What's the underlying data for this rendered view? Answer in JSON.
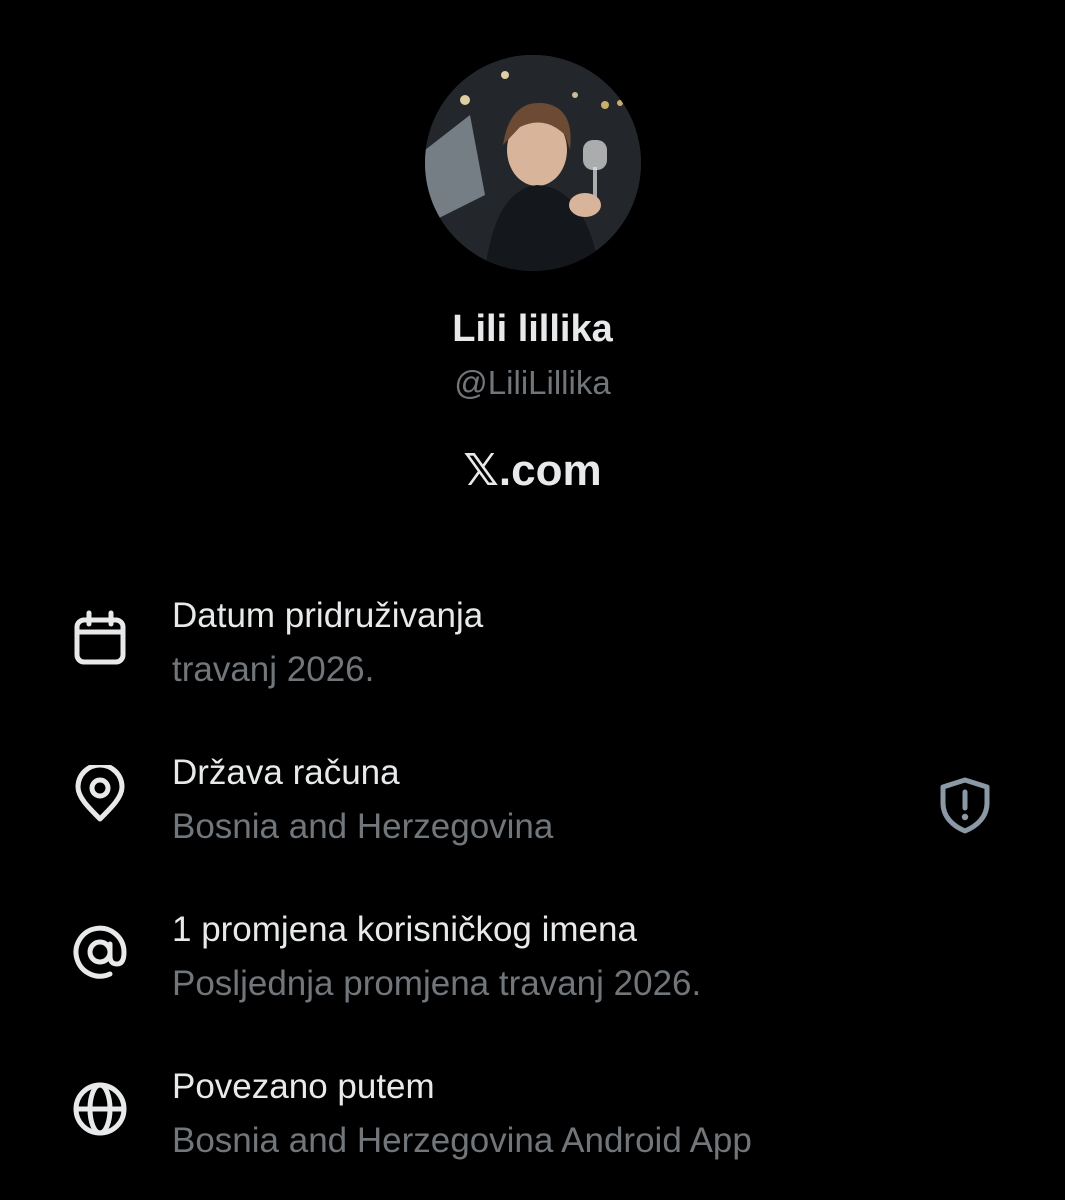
{
  "profile": {
    "display_name": "Lili lillika",
    "handle": "@LiliLillika",
    "brand": "𝕏.com"
  },
  "about": [
    {
      "icon": "calendar-icon",
      "label": "Datum pridruživanja",
      "value": "travanj 2026."
    },
    {
      "icon": "location-pin-icon",
      "label": "Država računa",
      "value": "Bosnia and Herzegovina",
      "badge_icon": "shield-alert-icon"
    },
    {
      "icon": "at-sign-icon",
      "label": "1 promjena korisničkog imena",
      "value": "Posljednja promjena travanj 2026."
    },
    {
      "icon": "globe-icon",
      "label": "Povezano putem",
      "value": "Bosnia and Herzegovina Android App"
    }
  ],
  "colors": {
    "background": "#000000",
    "primary_text": "#e7e9ea",
    "secondary_text": "#71767b"
  }
}
